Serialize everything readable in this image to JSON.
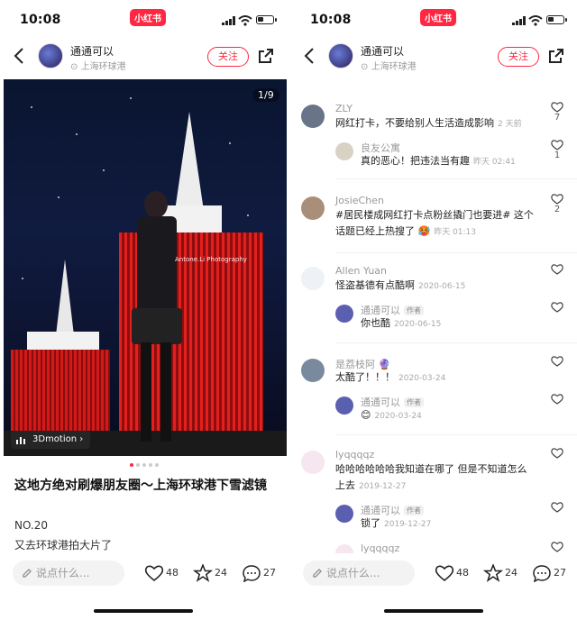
{
  "status": {
    "time": "10:08",
    "brand": "小红书"
  },
  "nav": {
    "author": "通通可以",
    "location": "上海环球港",
    "follow_label": "关注"
  },
  "post": {
    "image_counter": "1/9",
    "watermark": "Antone.Li Photography",
    "motion_label": "3Dmotion",
    "title": "这地方绝对刷爆朋友圈～上海环球港下雪滤镜",
    "line1": "NO.20",
    "line2": "又去环球港拍大片了"
  },
  "bottom": {
    "comment_placeholder": "说点什么...",
    "likes": "48",
    "stars": "24",
    "comments": "27"
  },
  "comments": [
    {
      "user": "ZLY",
      "text": "网红打卡，不要给别人生活造成影响",
      "time": "2 天前",
      "likes": "7"
    },
    {
      "user": "良友公寓",
      "text": "真的恶心！把违法当有趣",
      "time": "昨天 02:41",
      "likes": "1"
    },
    {
      "user": "JosieChen",
      "text1": "#居民楼成网红打卡点粉丝撬门也要进# 这个",
      "text2": "话题已经上热搜了",
      "time": "昨天 01:13",
      "likes": "2"
    },
    {
      "user": "Allen Yuan",
      "text": "怪盗基德有点酷啊",
      "time": "2020-06-15",
      "likes": ""
    },
    {
      "user": "通通可以",
      "tag": "作者",
      "text": "你也酷",
      "time": "2020-06-15",
      "likes": ""
    },
    {
      "user": "是荔枝阿",
      "text": "太酷了！！！",
      "time": "2020-03-24",
      "likes": ""
    },
    {
      "user": "通通可以",
      "tag": "作者",
      "text": "",
      "time": "2020-03-24",
      "likes": ""
    },
    {
      "user": "lyqqqqz",
      "text1": "哈哈哈哈哈哈我知道在哪了 但是不知道怎么",
      "text2": "上去",
      "time": "2019-12-27",
      "likes": ""
    },
    {
      "user": "通通可以",
      "tag": "作者",
      "text": "锁了",
      "time": "2019-12-27",
      "likes": ""
    },
    {
      "user": "lyqqqqz",
      "text": "",
      "time": "",
      "likes": ""
    }
  ],
  "colors": {
    "accent": "#ff2741",
    "muted": "#999999"
  }
}
